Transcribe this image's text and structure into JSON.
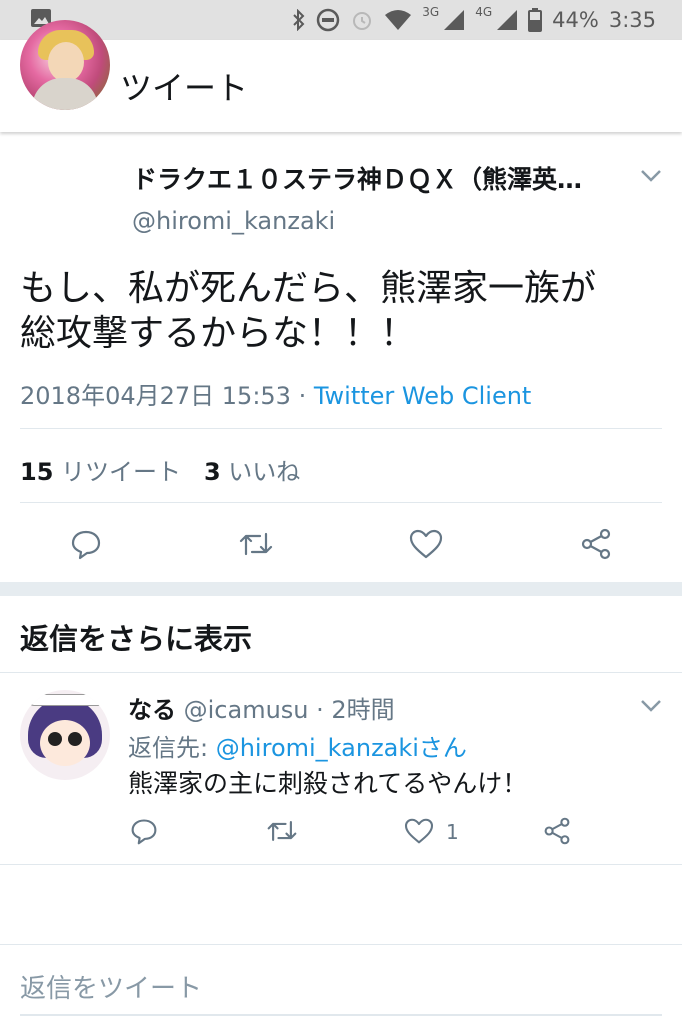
{
  "status_bar": {
    "network1": "3G",
    "network2": "4G",
    "battery": "44%",
    "time": "3:35"
  },
  "appbar": {
    "title": "ツイート"
  },
  "tweet": {
    "display_name": "ドラクエ１０ステラ神ＤＱＸ（熊澤英…",
    "handle": "@hiromi_kanzaki",
    "text_line1": "もし、私が死んだら、熊澤家一族が",
    "text_line2": "総攻撃するからな！！！",
    "timestamp": "2018年04月27日 15:53 · ",
    "client": "Twitter Web Client",
    "retweet_count": "15",
    "retweet_label": "リツイート",
    "like_count": "3",
    "like_label": "いいね"
  },
  "replies_section": {
    "heading": "返信をさらに表示"
  },
  "reply": {
    "name": "なる",
    "handle_time": "@icamusu · 2時間",
    "reply_prefix": "返信先: ",
    "reply_to": "@hiromi_kanzakiさん",
    "text": "熊澤家の主に刺殺されてるやんけ！",
    "like_count": "1"
  },
  "compose": {
    "placeholder": "返信をツイート"
  },
  "colors": {
    "accent": "#1b95e0",
    "muted": "#657786",
    "text": "#14171a",
    "separator": "#e6ecf0"
  }
}
